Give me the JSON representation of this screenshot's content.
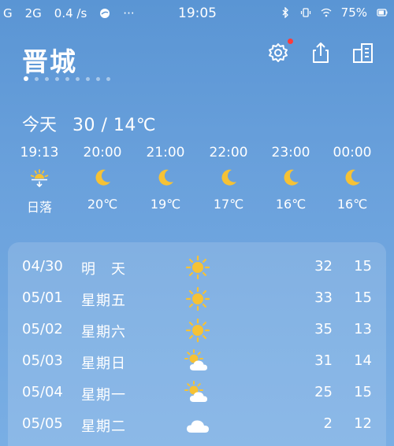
{
  "status_bar": {
    "left_signal_1": "G",
    "left_signal_2": "2G",
    "speed": "0.4 /s",
    "time": "19:05",
    "battery": "75%"
  },
  "header": {
    "city": "晋城",
    "page_count": 9,
    "active_page": 0,
    "icons": [
      "settings-icon",
      "share-icon",
      "city-list-icon"
    ]
  },
  "today": {
    "label": "今天",
    "temp_range": "30 / 14℃"
  },
  "hourly": [
    {
      "time": "19:13",
      "icon": "sunset-icon",
      "temp": "日落"
    },
    {
      "time": "20:00",
      "icon": "moon-icon",
      "temp": "20℃"
    },
    {
      "time": "21:00",
      "icon": "moon-icon",
      "temp": "19℃"
    },
    {
      "time": "22:00",
      "icon": "moon-icon",
      "temp": "17℃"
    },
    {
      "time": "23:00",
      "icon": "moon-icon",
      "temp": "16℃"
    },
    {
      "time": "00:00",
      "icon": "moon-icon",
      "temp": "16℃"
    }
  ],
  "daily": [
    {
      "date": "04/30",
      "name": "明　天",
      "icon": "sun-icon",
      "high": "32",
      "low": "15"
    },
    {
      "date": "05/01",
      "name": "星期五",
      "icon": "sun-icon",
      "high": "33",
      "low": "15"
    },
    {
      "date": "05/02",
      "name": "星期六",
      "icon": "sun-icon",
      "high": "35",
      "low": "13"
    },
    {
      "date": "05/03",
      "name": "星期日",
      "icon": "partly-cloudy-icon",
      "high": "31",
      "low": "14"
    },
    {
      "date": "05/04",
      "name": "星期一",
      "icon": "partly-cloudy-icon",
      "high": "25",
      "low": "15"
    },
    {
      "date": "05/05",
      "name": "星期二",
      "icon": "cloud-icon",
      "high": "2",
      "low": "12"
    }
  ],
  "colors": {
    "sun": "#f6c235",
    "moon": "#f6c235",
    "cloud": "#ffffff",
    "settings_dot": "#ff3b3b"
  }
}
